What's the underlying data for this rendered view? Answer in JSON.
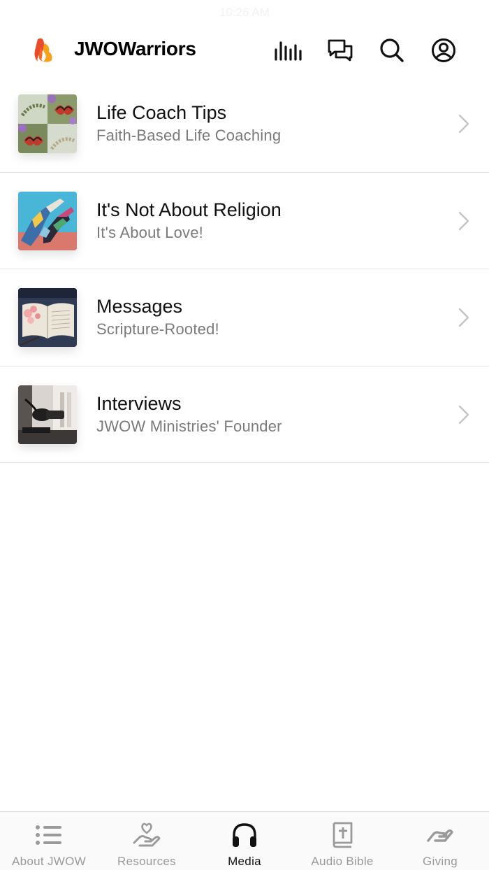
{
  "status": {
    "time": "10:26 AM"
  },
  "header": {
    "title": "JWOWarriors",
    "icons": [
      "live-audio-icon",
      "chat-icon",
      "search-icon",
      "account-icon"
    ],
    "logo_colors": [
      "#e94b2b",
      "#f7a21b"
    ]
  },
  "list": [
    {
      "title": "Life Coach Tips",
      "subtitle": "Faith-Based Life Coaching"
    },
    {
      "title": "It's Not About Religion",
      "subtitle": "It's About Love!"
    },
    {
      "title": "Messages",
      "subtitle": "Scripture-Rooted!"
    },
    {
      "title": "Interviews",
      "subtitle": "JWOW Ministries' Founder"
    }
  ],
  "tabs": [
    {
      "label": "About JWOW",
      "icon": "list-icon",
      "active": false
    },
    {
      "label": "Resources",
      "icon": "heart-hand-icon",
      "active": false
    },
    {
      "label": "Media",
      "icon": "headphones-icon",
      "active": true
    },
    {
      "label": "Audio Bible",
      "icon": "bible-icon",
      "active": false
    },
    {
      "label": "Giving",
      "icon": "giving-hand-icon",
      "active": false
    }
  ],
  "colors": {
    "active_tab": "#111111",
    "inactive_tab": "#9a9a9a",
    "divider": "#e3e3e6"
  }
}
